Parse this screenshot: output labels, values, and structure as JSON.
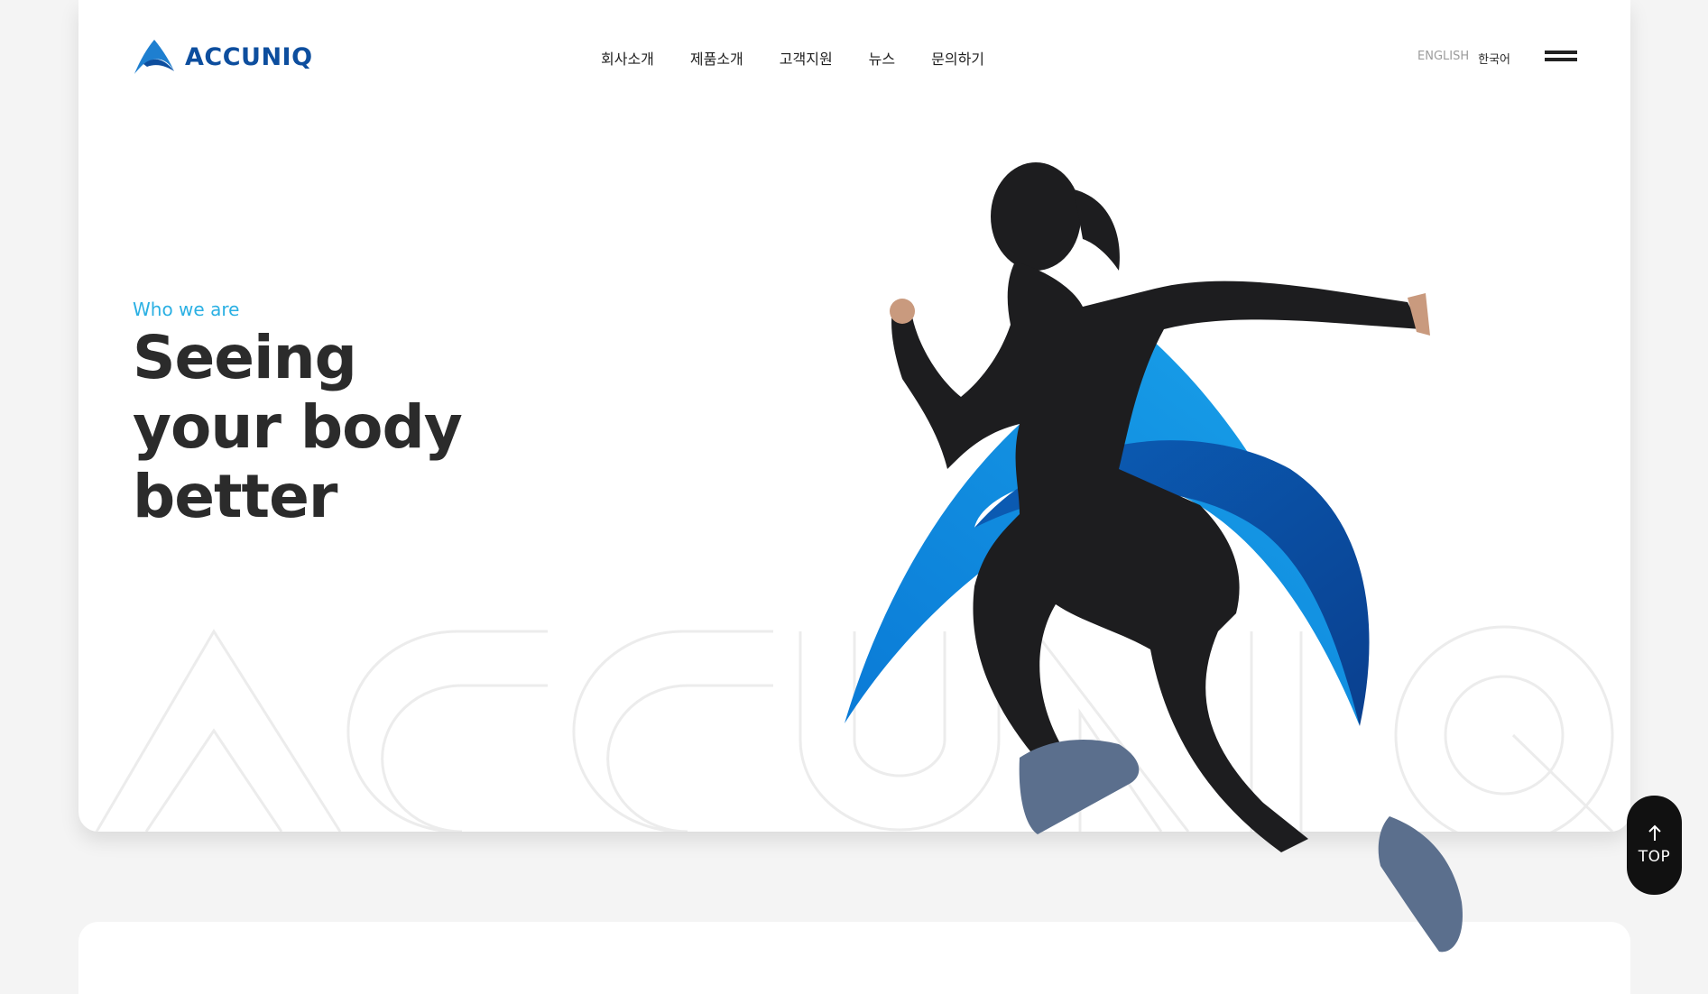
{
  "brand": {
    "name": "ACCUNIQ",
    "logo_icon": "accuniq-a-logo-icon",
    "color": "#0d4e9e"
  },
  "nav": {
    "items": [
      {
        "label": "회사소개"
      },
      {
        "label": "제품소개"
      },
      {
        "label": "고객지원"
      },
      {
        "label": "뉴스"
      },
      {
        "label": "문의하기"
      }
    ]
  },
  "language": {
    "english": "ENGLISH",
    "korean": "한국어",
    "active": "한국어"
  },
  "menu": {
    "icon": "hamburger-icon"
  },
  "hero": {
    "tagline": "Who we are",
    "headline_lines": [
      "Seeing",
      "your body",
      "better"
    ],
    "watermark_icon": "accuniq-outline-watermark",
    "image": "runner-with-blue-a-graphic",
    "accent_color": "#2bb0e3",
    "graphic_color": "#0a66c2"
  },
  "scroll_top": {
    "label": "TOP",
    "icon": "arrow-up-icon"
  }
}
